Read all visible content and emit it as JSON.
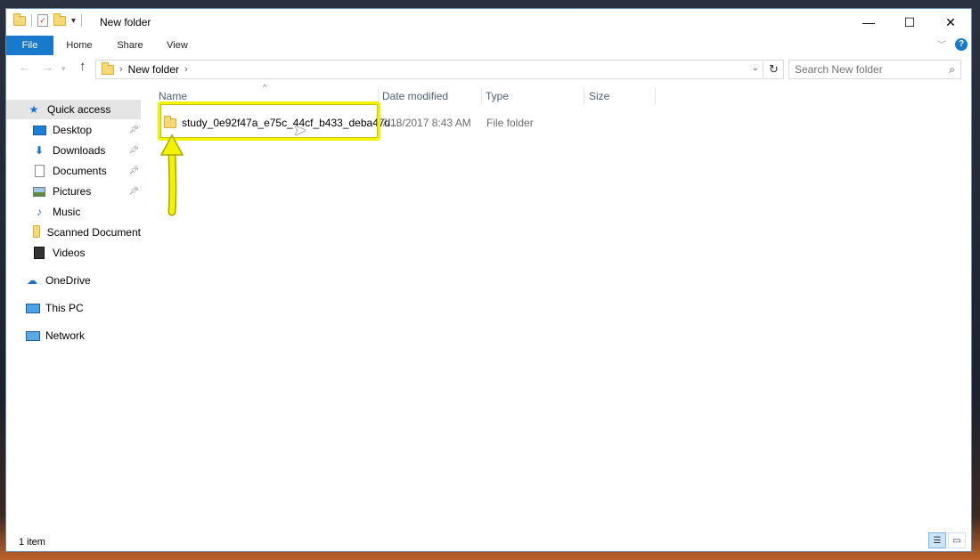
{
  "window": {
    "title": "New folder",
    "controls": {
      "minimize": "—",
      "maximize": "☐",
      "close": "✕"
    }
  },
  "ribbon": {
    "tabs": [
      "File",
      "Home",
      "Share",
      "View"
    ],
    "help_label": "?"
  },
  "address_bar": {
    "crumbs": [
      "New folder"
    ],
    "search_placeholder": "Search New folder"
  },
  "nav_pane": {
    "quick_access": "Quick access",
    "items": [
      "Desktop",
      "Downloads",
      "Documents",
      "Pictures",
      "Music",
      "Scanned Document",
      "Videos"
    ],
    "onedrive": "OneDrive",
    "this_pc": "This PC",
    "network": "Network"
  },
  "file_list": {
    "columns": [
      "Name",
      "Date modified",
      "Type",
      "Size"
    ],
    "rows": [
      {
        "name": "study_0e92f47a_e75c_44cf_b433_deba47d...",
        "date_modified": "7/18/2017 8:43 AM",
        "type": "File folder",
        "size": ""
      }
    ]
  },
  "status_bar": {
    "item_count": "1 item"
  },
  "colors": {
    "accent": "#1979ca",
    "highlight": "#f3f300",
    "folder": "#f8d775"
  }
}
